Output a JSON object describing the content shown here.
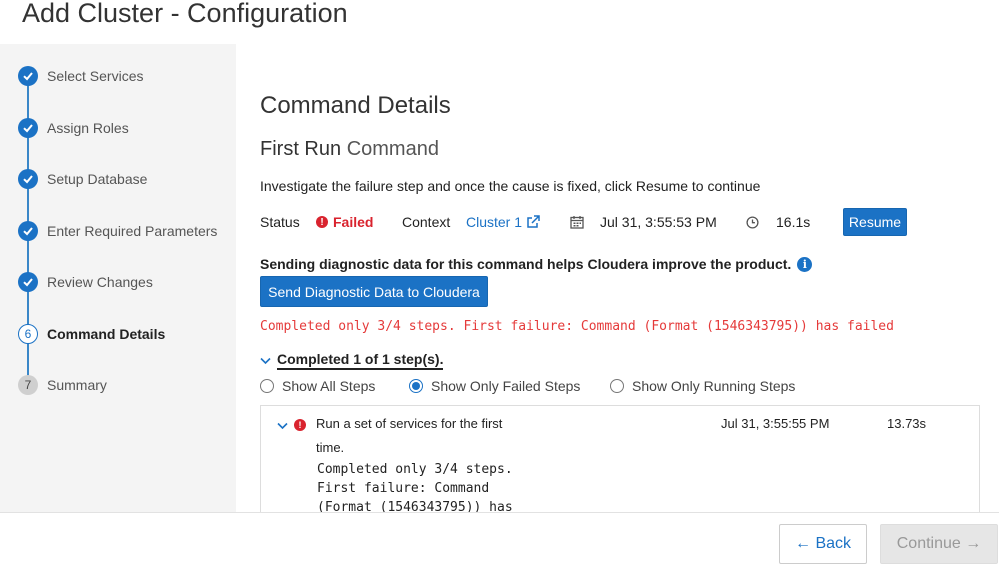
{
  "page_title": "Add Cluster - Configuration",
  "sidebar": {
    "steps": [
      {
        "label": "Select Services",
        "state": "done"
      },
      {
        "label": "Assign Roles",
        "state": "done"
      },
      {
        "label": "Setup Database",
        "state": "done"
      },
      {
        "label": "Enter Required Parameters",
        "state": "done"
      },
      {
        "label": "Review Changes",
        "state": "done"
      },
      {
        "label": "Command Details",
        "state": "current",
        "number": "6"
      },
      {
        "label": "Summary",
        "state": "todo",
        "number": "7"
      }
    ]
  },
  "main": {
    "heading": "Command Details",
    "subheading_prefix": "First Run",
    "subheading_suffix": "Command",
    "instruction": "Investigate the failure step and once the cause is fixed, click Resume to continue",
    "status_label": "Status",
    "status_value": "Failed",
    "context_label": "Context",
    "context_link": "Cluster 1",
    "timestamp": "Jul 31, 3:55:53 PM",
    "duration": "16.1s",
    "resume_label": "Resume",
    "diagnostic_text": "Sending diagnostic data for this command helps Cloudera improve the product.",
    "diagnostic_button": "Send Diagnostic Data to Cloudera",
    "error_message": "Completed only 3/4 steps. First failure: Command (Format (1546343795)) has failed",
    "completed_label": "Completed 1 of 1 step(s).",
    "filters": [
      {
        "label": "Show All Steps",
        "selected": false
      },
      {
        "label": "Show Only Failed Steps",
        "selected": true
      },
      {
        "label": "Show Only Running Steps",
        "selected": false
      }
    ],
    "step_row": {
      "description": "Run a set of services for the first time.",
      "time": "Jul 31, 3:55:55 PM",
      "duration": "13.73s",
      "detail_lines": [
        "Completed only 3/4 steps.",
        "First failure: Command",
        "(Format (1546343795)) has"
      ]
    }
  },
  "footer": {
    "back_label": "Back",
    "continue_label": "Continue"
  },
  "colors": {
    "accent": "#1b72c5",
    "error": "#d9232e"
  }
}
